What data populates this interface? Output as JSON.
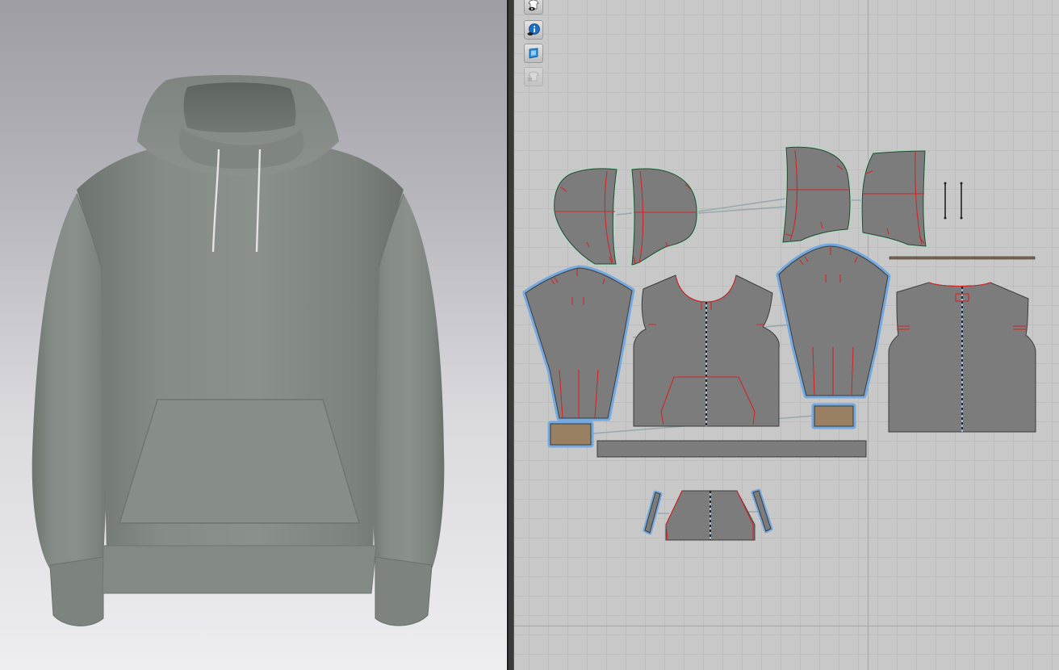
{
  "viewport_3d": {
    "garment": "hoodie",
    "garment_color": "#848a85",
    "background_top": "#9d9da3",
    "background_bottom": "#eeeef1"
  },
  "viewport_2d": {
    "grid_color": "#bdbdbd",
    "canvas_color": "#c8c8c8",
    "selection_color": "#6fa8e0",
    "seam_marker_color": "#d22626",
    "toolbar": {
      "items": [
        {
          "icon": "garment-visibility-icon",
          "enabled": true
        },
        {
          "icon": "info-icon",
          "enabled": true
        },
        {
          "icon": "texture-icon",
          "enabled": true
        },
        {
          "icon": "lock-garment-icon",
          "enabled": false
        }
      ]
    },
    "pattern_pieces": [
      "hood-left-side",
      "hood-left-center",
      "hood-right-center",
      "hood-right-side",
      "drawcord-strips",
      "hem-strip-top",
      "left-sleeve",
      "front-body",
      "right-sleeve",
      "back-body",
      "left-cuff",
      "right-cuff",
      "waist-band",
      "pocket",
      "pocket-facing-left",
      "pocket-facing-right"
    ]
  }
}
